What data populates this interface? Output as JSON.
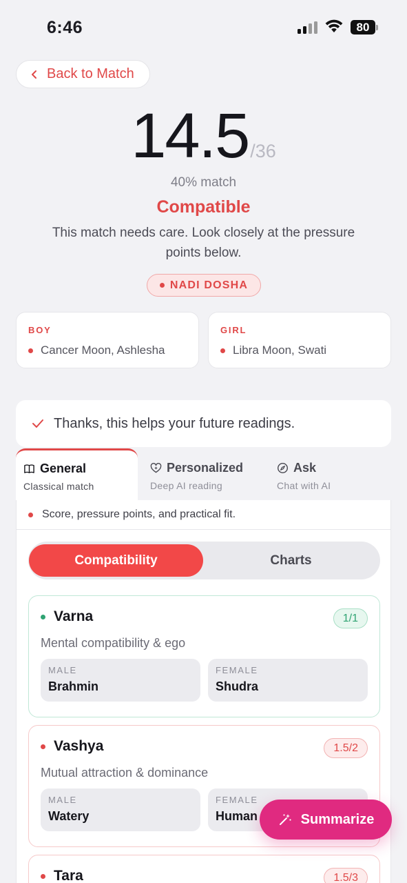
{
  "status_bar": {
    "time": "6:46",
    "battery": "80"
  },
  "back_button": {
    "label": "Back to Match"
  },
  "score": {
    "value": "14.5",
    "total": "/36",
    "match_percent": "40% match",
    "verdict": "Compatible",
    "description": "This match needs care. Look closely at the pressure points below.",
    "badge": "NADI DOSHA"
  },
  "boy": {
    "role": "BOY",
    "detail": "Cancer Moon, Ashlesha"
  },
  "girl": {
    "role": "GIRL",
    "detail": "Libra Moon, Swati"
  },
  "thanks_message": "Thanks, this helps your future readings.",
  "tabs": [
    {
      "title": "General",
      "subtitle": "Classical match",
      "icon": "book-icon",
      "active": true
    },
    {
      "title": "Personalized",
      "subtitle": "Deep AI reading",
      "icon": "heart-sparkle-icon",
      "active": false
    },
    {
      "title": "Ask",
      "subtitle": "Chat with AI",
      "icon": "compass-icon",
      "active": false
    }
  ],
  "panel_note": "Score, pressure points, and practical fit.",
  "segments": {
    "active": "Compatibility",
    "inactive": "Charts"
  },
  "kootas": [
    {
      "name": "Varna",
      "score": "1/1",
      "status": "good",
      "description": "Mental compatibility & ego",
      "male_label": "MALE",
      "male_value": "Brahmin",
      "female_label": "FEMALE",
      "female_value": "Shudra"
    },
    {
      "name": "Vashya",
      "score": "1.5/2",
      "status": "warn",
      "description": "Mutual attraction & dominance",
      "male_label": "MALE",
      "male_value": "Watery",
      "female_label": "FEMALE",
      "female_value": "Human"
    },
    {
      "name": "Tara",
      "score": "1.5/3",
      "status": "warn"
    }
  ],
  "summarize_button": {
    "label": "Summarize"
  },
  "colors": {
    "accent_red": "#e04848",
    "good_green": "#2fa372",
    "summarize_pink": "#e02a80"
  }
}
